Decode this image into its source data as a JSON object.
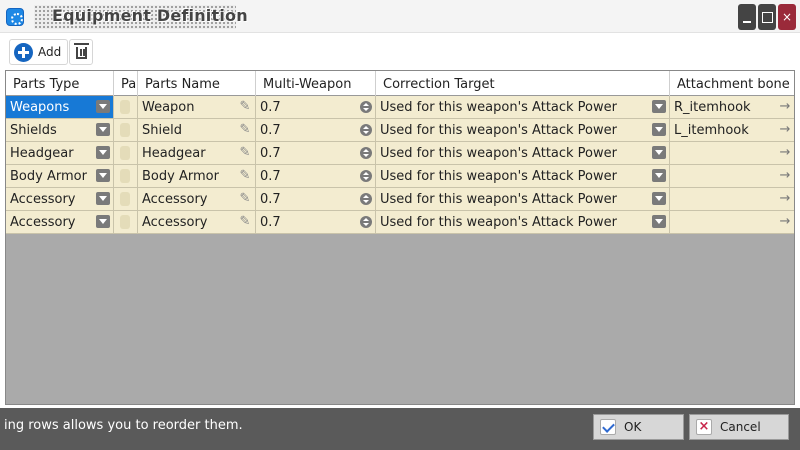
{
  "window": {
    "title": "Equipment Definition",
    "buttons": {
      "minimize": "minimize",
      "maximize": "maximize",
      "close": "×"
    }
  },
  "toolbar": {
    "add_label": "Add",
    "delete_icon": "trash-icon"
  },
  "grid": {
    "columns": [
      "Parts Type",
      "Pa",
      "Parts Name",
      "Multi-Weapon",
      "Correction Target",
      "Attachment bone"
    ],
    "rows": [
      {
        "type": "Weapons",
        "name": "Weapon",
        "multi": "0.7",
        "target": "Used for this weapon's Attack Power",
        "bone": "R_itemhook"
      },
      {
        "type": "Shields",
        "name": "Shield",
        "multi": "0.7",
        "target": "Used for this weapon's Attack Power",
        "bone": "L_itemhook"
      },
      {
        "type": "Headgear",
        "name": "Headgear",
        "multi": "0.7",
        "target": "Used for this weapon's Attack Power",
        "bone": ""
      },
      {
        "type": "Body Armor",
        "name": "Body Armor",
        "multi": "0.7",
        "target": "Used for this weapon's Attack Power",
        "bone": ""
      },
      {
        "type": "Accessory",
        "name": "Accessory",
        "multi": "0.7",
        "target": "Used for this weapon's Attack Power",
        "bone": ""
      },
      {
        "type": "Accessory",
        "name": "Accessory",
        "multi": "0.7",
        "target": "Used for this weapon's Attack Power",
        "bone": ""
      }
    ],
    "selected_row": 0
  },
  "footer": {
    "hint": "ing rows allows you to reorder them.",
    "ok_label": "OK",
    "cancel_label": "Cancel"
  },
  "colors": {
    "row_bg": "#f3ecd0",
    "selection": "#1779d6",
    "grid_empty": "#aaaaaa",
    "footer_bg": "#5a5a5a"
  }
}
